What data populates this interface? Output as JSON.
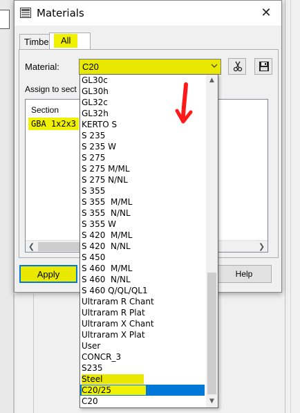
{
  "dialog": {
    "title": "Materials",
    "close_glyph": "✕",
    "title_icon": "materials-window-icon"
  },
  "tabs": [
    {
      "label": "Timber",
      "active": false
    },
    {
      "label": "All",
      "active": true
    }
  ],
  "material_label": "Material:",
  "material_value": "C20",
  "assign_label": "Assign to sect",
  "section_header": "Section",
  "section_item": "GBA 1x2x3",
  "buttons": {
    "apply": "Apply",
    "help": "Help"
  },
  "icons": {
    "cut": "scissors-icon",
    "save": "floppy-disk-icon"
  },
  "dropdown_items": [
    "GL30c",
    "GL30h",
    "GL32c",
    "GL32h",
    "KERTO S",
    "S 235",
    "S 235 W",
    "S 275",
    "S 275 M/ML",
    "S 275 N/NL",
    "S 355",
    "S 355  M/ML",
    "S 355  N/NL",
    "S 355 W",
    "S 420  M/ML",
    "S 420  N/NL",
    "S 450",
    "S 460  M/ML",
    "S 460  N/NL",
    "S 460 Q/QL/QL1",
    "Ultraram R Chant",
    "Ultraram R Plat",
    "Ultraram X Chant",
    "Ultraram X Plat",
    "User",
    "CONCR_3",
    "S235",
    "Steel",
    "C20/25",
    "C20"
  ],
  "dropdown_highlighted": "Steel",
  "dropdown_selected": "C20/25",
  "colors": {
    "highlight_yellow": "#f0f100",
    "selection_blue": "#0078d7",
    "annotation_red": "#ff1a1a"
  }
}
